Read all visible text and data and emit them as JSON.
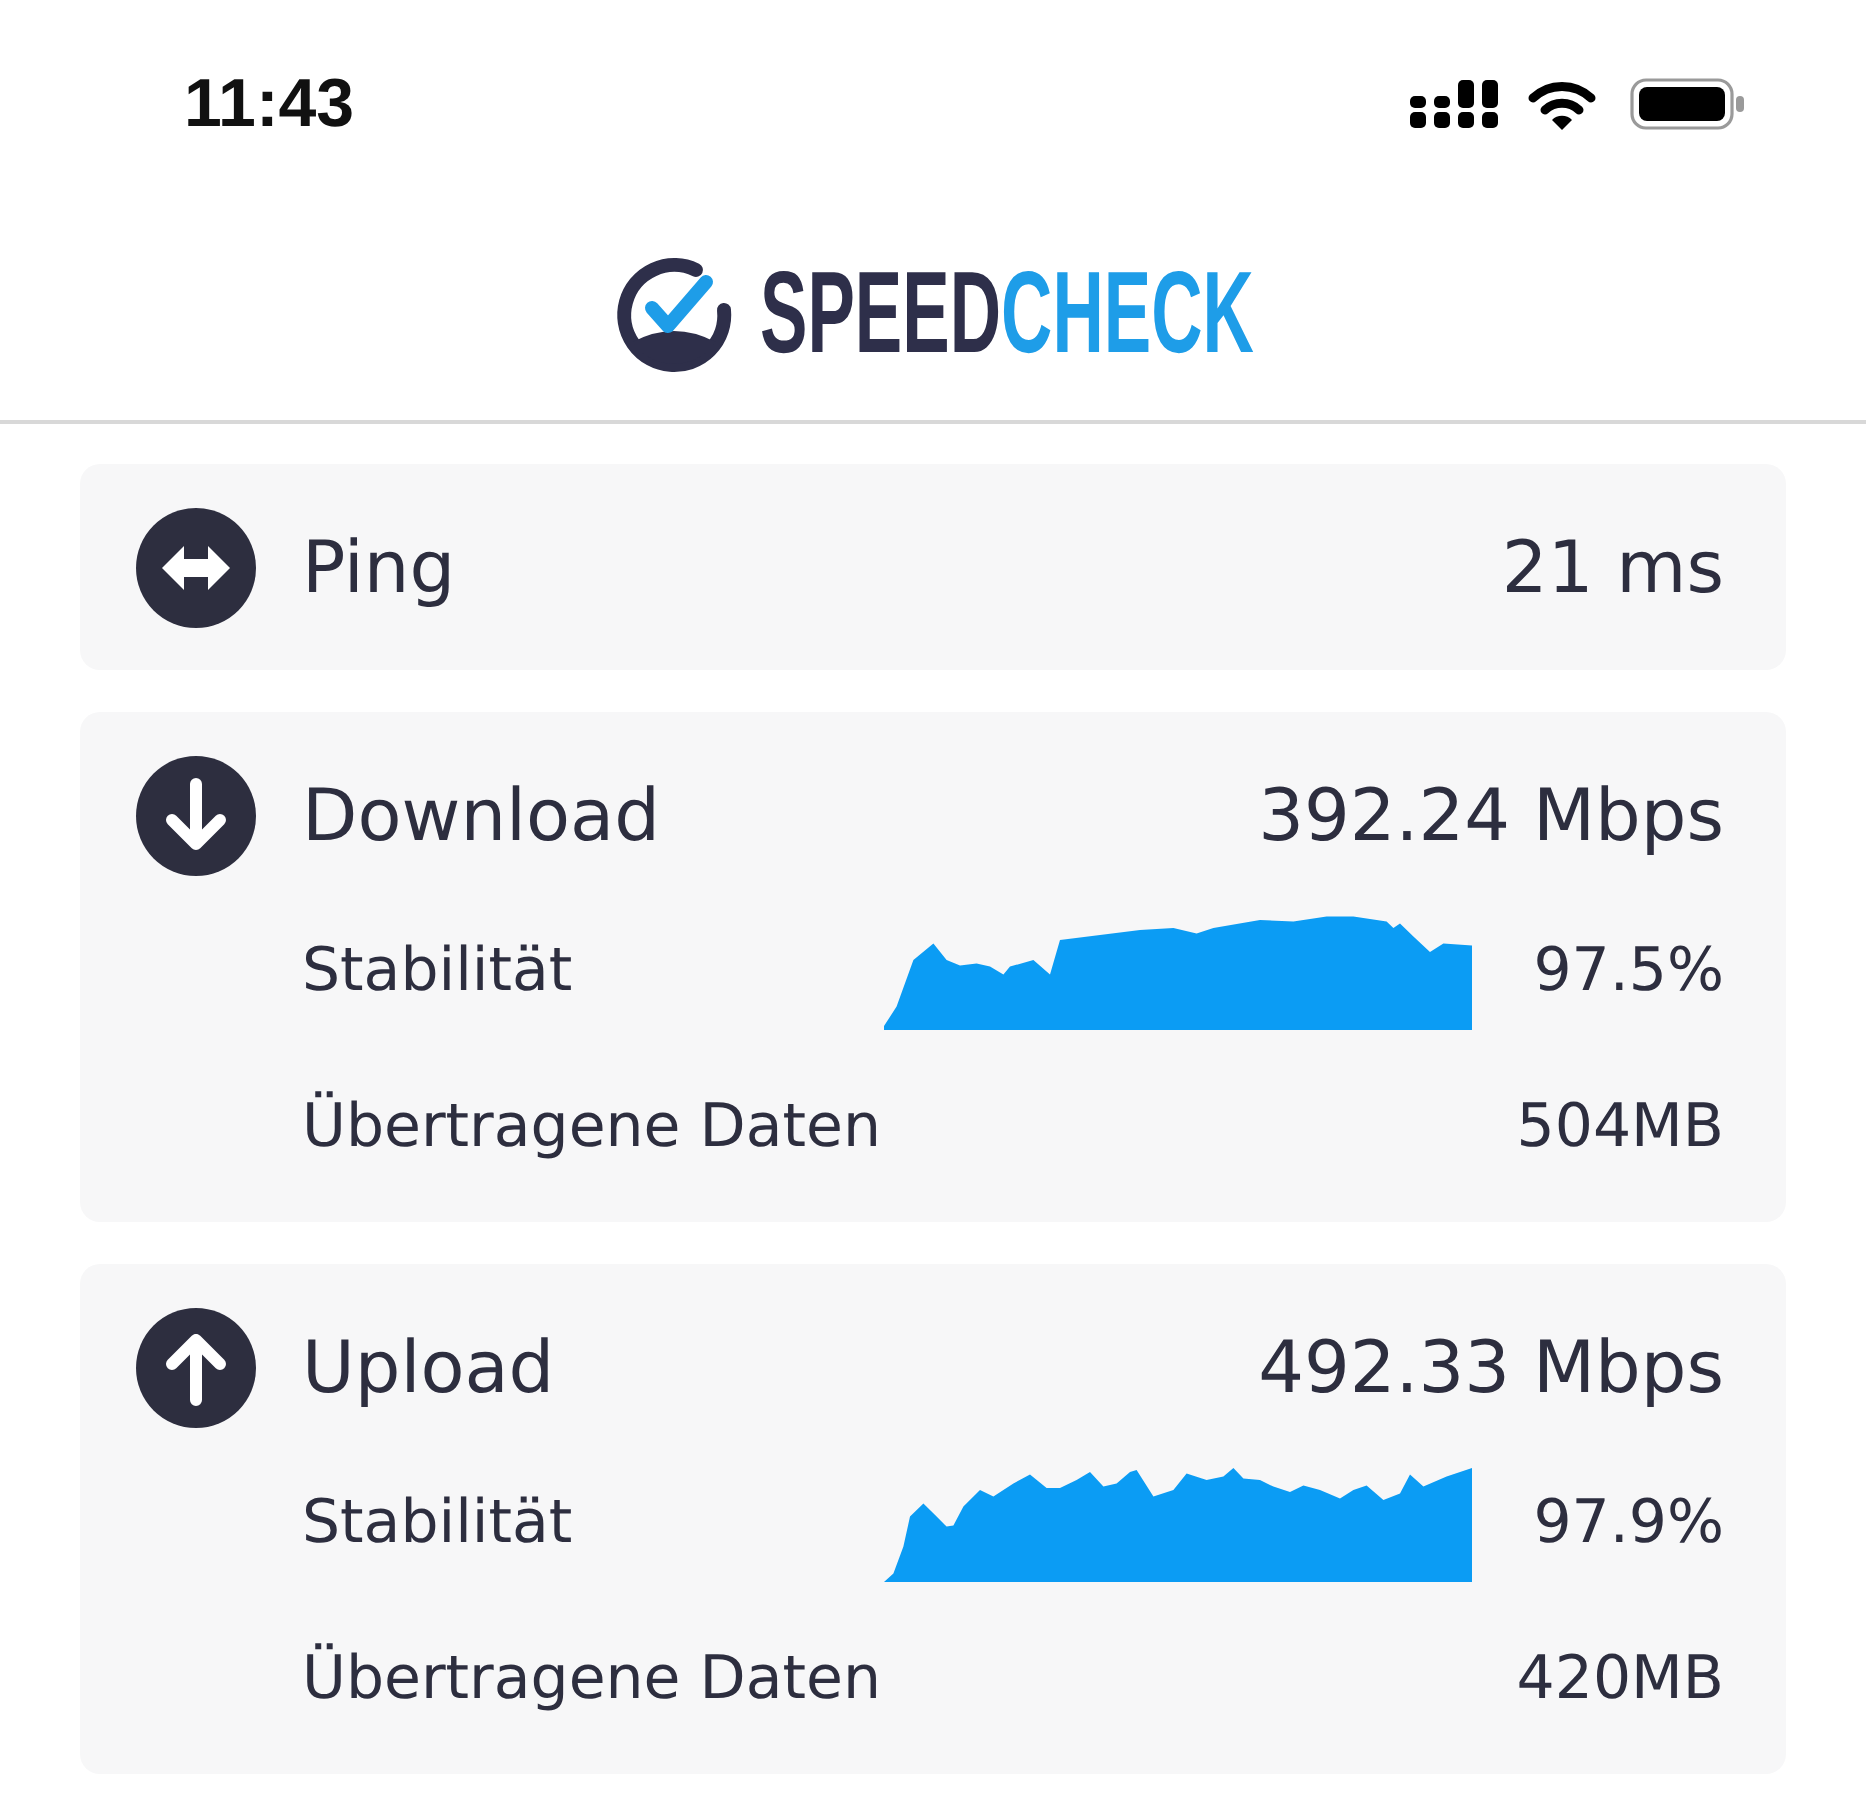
{
  "status_bar": {
    "time": "11:43"
  },
  "header": {
    "logo": [
      {
        "text": "SPEED",
        "color": "#2e2f4a"
      },
      {
        "text": "CHECK",
        "color": "#1e9de8"
      }
    ]
  },
  "results": [
    {
      "kind": "ping",
      "label": "Ping",
      "value": "21 ms"
    },
    {
      "kind": "download",
      "label": "Download",
      "value": "392.24 Mbps",
      "details": [
        {
          "kind": "stability",
          "label": "Stabilität",
          "value": "97.5%"
        },
        {
          "kind": "transferred",
          "label": "Übertragene Daten",
          "value": "504MB"
        }
      ]
    },
    {
      "kind": "upload",
      "label": "Upload",
      "value": "492.33 Mbps",
      "details": [
        {
          "kind": "stability",
          "label": "Stabilität",
          "value": "97.9%"
        },
        {
          "kind": "transferred",
          "label": "Übertragene Daten",
          "value": "420MB"
        }
      ]
    }
  ]
}
